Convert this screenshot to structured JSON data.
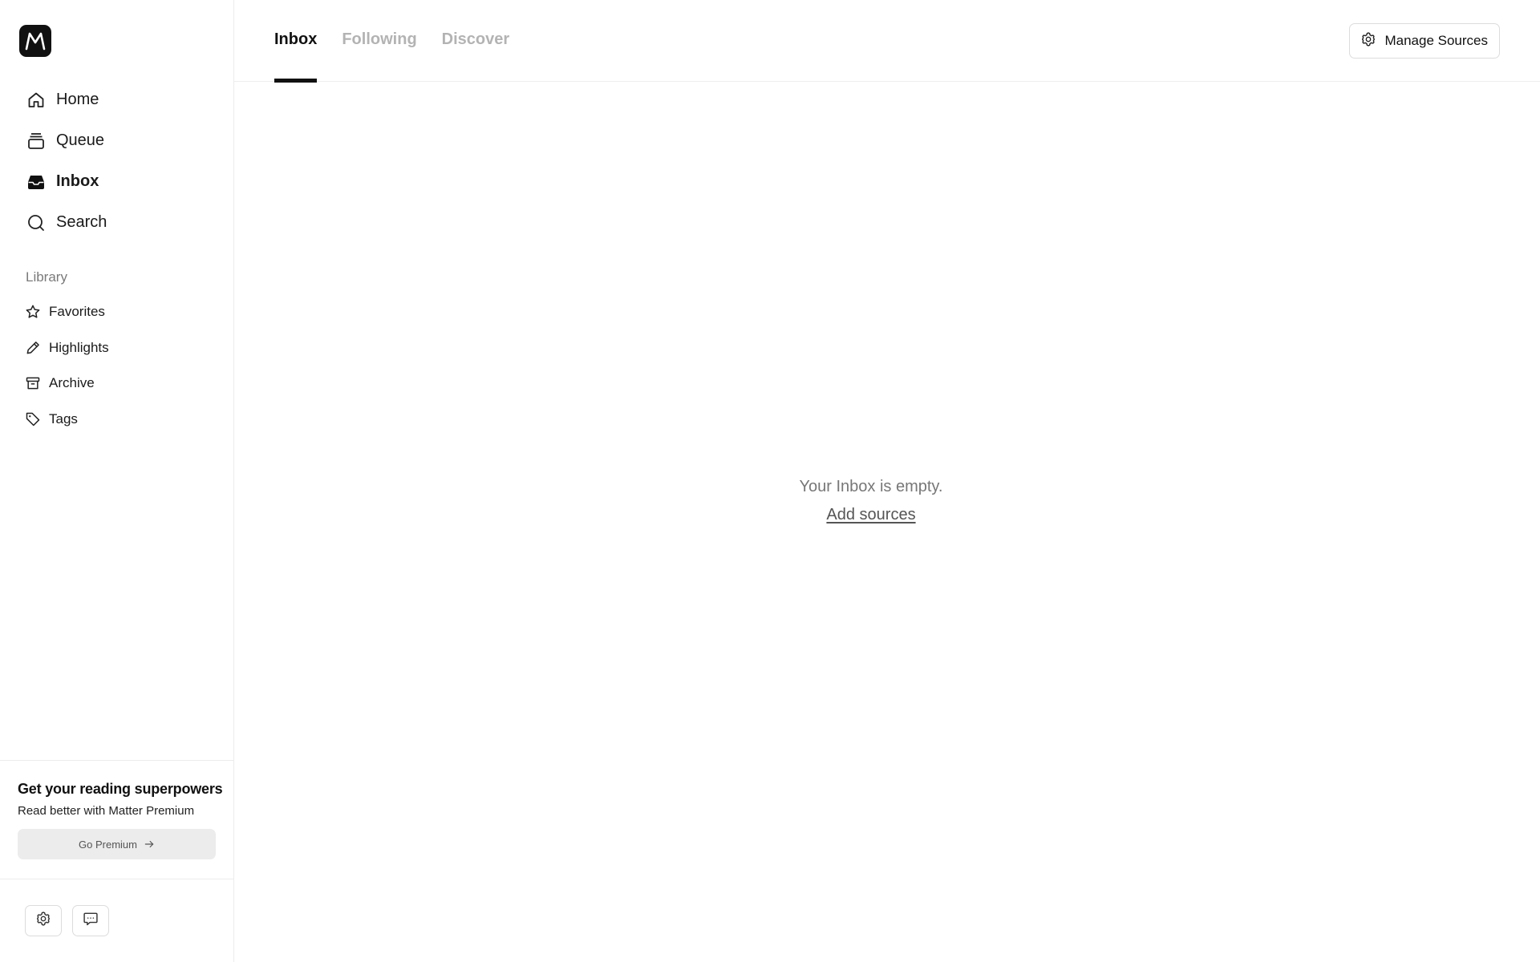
{
  "app": {
    "logo_letter": "M",
    "accent_color": "#111111"
  },
  "sidebar": {
    "nav": [
      {
        "label": "Home",
        "icon": "home-icon"
      },
      {
        "label": "Queue",
        "icon": "queue-icon"
      },
      {
        "label": "Inbox",
        "icon": "inbox-icon",
        "active": true
      },
      {
        "label": "Search",
        "icon": "search-icon"
      }
    ],
    "library_heading": "Library",
    "library": [
      {
        "label": "Favorites",
        "icon": "star-icon"
      },
      {
        "label": "Highlights",
        "icon": "pen-icon"
      },
      {
        "label": "Archive",
        "icon": "archive-icon"
      },
      {
        "label": "Tags",
        "icon": "tag-icon"
      }
    ],
    "promo": {
      "title": "Get your reading superpowers",
      "subtitle": "Read better with Matter Premium",
      "button_label": "Go Premium"
    },
    "tools": [
      {
        "icon": "gear-icon"
      },
      {
        "icon": "chat-icon"
      }
    ]
  },
  "header": {
    "tabs": [
      {
        "label": "Inbox",
        "active": true
      },
      {
        "label": "Following"
      },
      {
        "label": "Discover"
      }
    ],
    "manage_label": "Manage Sources"
  },
  "main": {
    "empty_text": "Your Inbox is empty.",
    "empty_link": "Add sources"
  }
}
